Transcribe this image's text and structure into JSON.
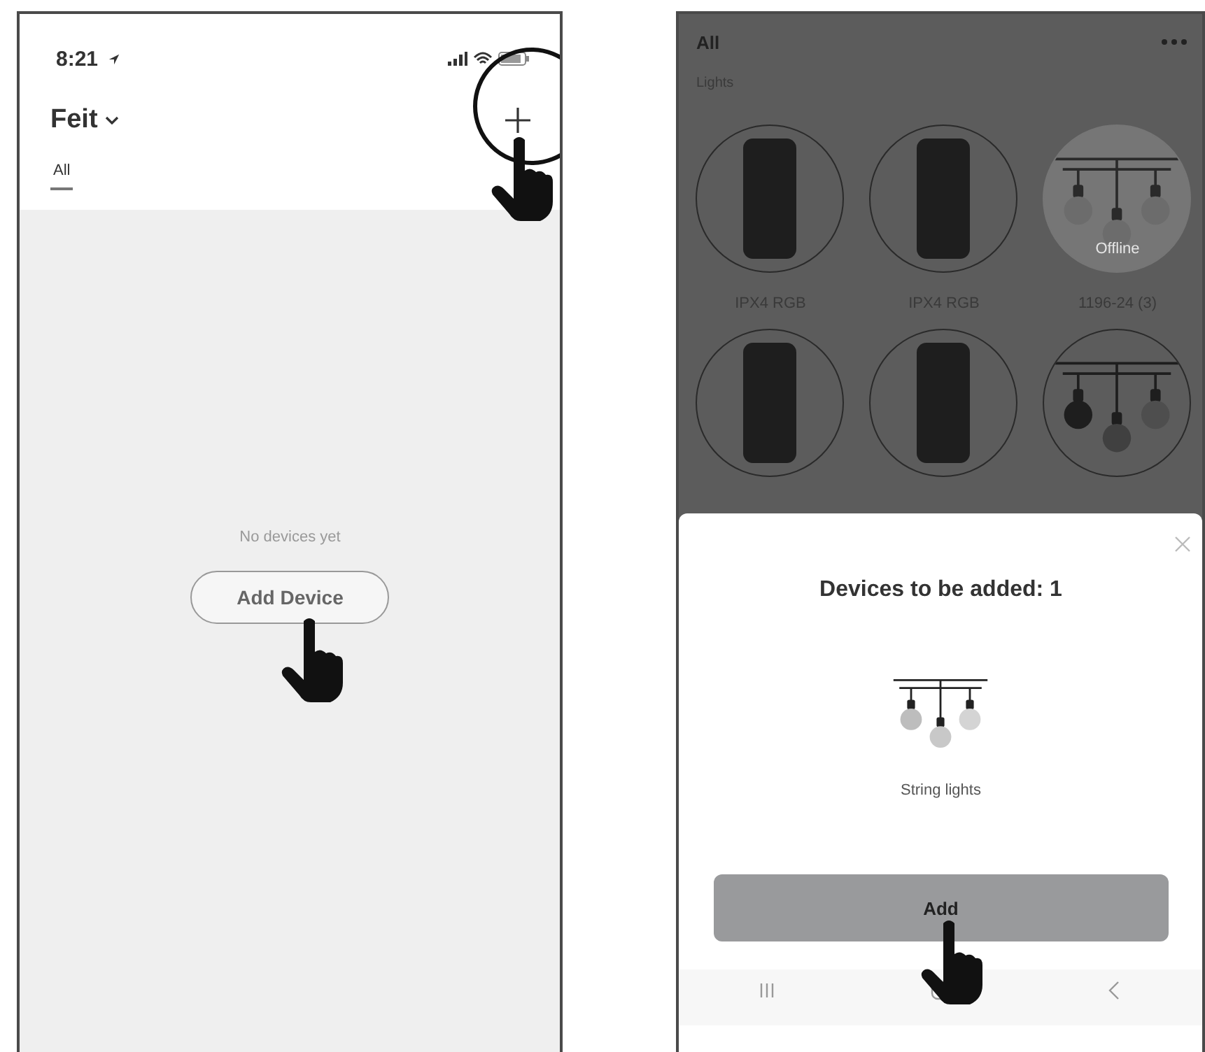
{
  "left_screen": {
    "status_bar": {
      "time": "8:21"
    },
    "header": {
      "home": "Feit"
    },
    "tabs": [
      {
        "label": "All",
        "selected": true
      }
    ],
    "empty_state": {
      "message": "No devices yet",
      "button": "Add Device"
    }
  },
  "right_screen": {
    "header": {
      "title": "All"
    },
    "section": "Lights",
    "devices": [
      {
        "name": "IPX4 RGB",
        "kind": "strip",
        "offline": false
      },
      {
        "name": "IPX4 RGB",
        "kind": "strip",
        "offline": false
      },
      {
        "name": "1196-24 (3)",
        "kind": "string",
        "offline": true,
        "status_label": "Offline"
      },
      {
        "kind": "strip",
        "offline": false
      },
      {
        "kind": "strip",
        "offline": false
      },
      {
        "kind": "string",
        "offline": false
      }
    ],
    "sheet": {
      "title": "Devices to be added: 1",
      "device": "String lights",
      "button": "Add"
    }
  }
}
